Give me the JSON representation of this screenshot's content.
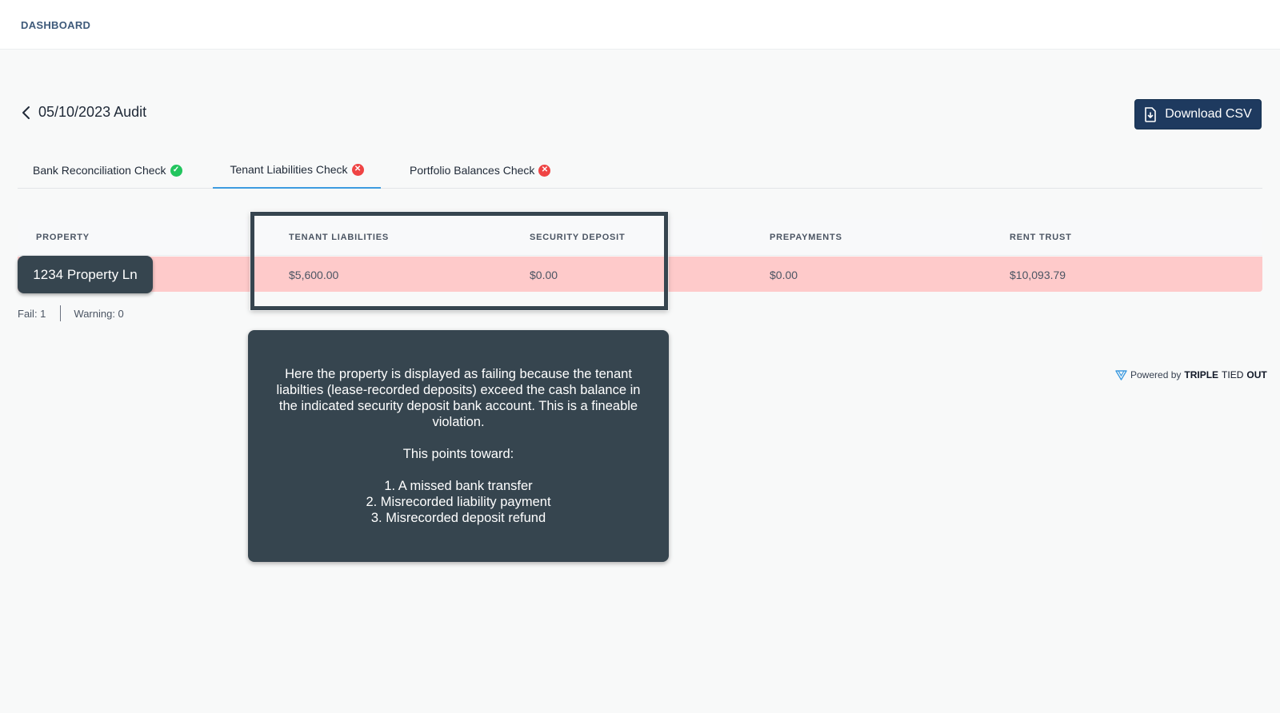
{
  "topbar": {
    "nav_label": "DASHBOARD"
  },
  "header": {
    "title": "05/10/2023 Audit",
    "download_label": "Download CSV"
  },
  "tabs": [
    {
      "label": "Bank Reconciliation Check",
      "status": "pass"
    },
    {
      "label": "Tenant Liabilities Check",
      "status": "fail",
      "active": true
    },
    {
      "label": "Portfolio Balances Check",
      "status": "fail"
    }
  ],
  "table": {
    "columns": [
      "PROPERTY",
      "TENANT LIABILITIES",
      "SECURITY DEPOSIT",
      "PREPAYMENTS",
      "RENT TRUST"
    ],
    "rows": [
      {
        "property": "1234 Property Ln",
        "tenant_liabilities": "$5,600.00",
        "security_deposit": "$0.00",
        "prepayments": "$0.00",
        "rent_trust": "$10,093.79"
      }
    ]
  },
  "summary": {
    "fail": "Fail: 1",
    "warning": "Warning: 0"
  },
  "tooltip": {
    "paragraph": "Here the property is displayed as failing because the tenant liabilties (lease-recorded deposits) exceed the cash balance in the indicated security deposit bank account. This is a fineable violation.",
    "lead": "This points toward:",
    "items": [
      "1. A missed bank transfer",
      "2. Misrecorded liability payment",
      "3. Misrecorded deposit refund"
    ]
  },
  "footer": {
    "prefix": "Powered by",
    "brand_bold": "TRIPLE",
    "brand_mid": "TIED",
    "brand_end": "OUT"
  },
  "colors": {
    "primary": "#1e3a5f",
    "fail_row": "#fecaca",
    "tooltip_bg": "#36454f",
    "active_tab": "#3d9be0",
    "pass": "#22c55e",
    "fail": "#ef4444"
  }
}
